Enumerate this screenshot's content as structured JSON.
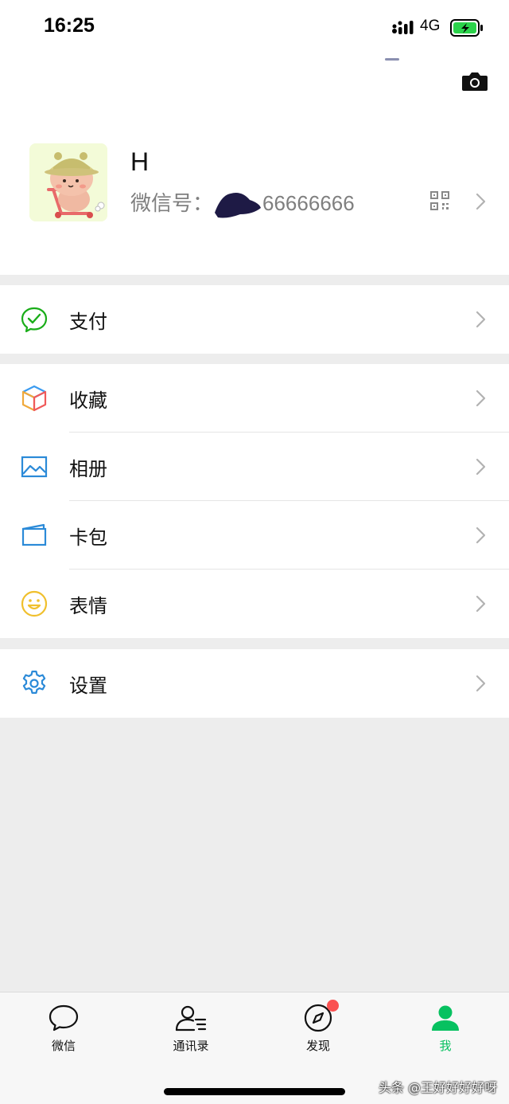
{
  "status_bar": {
    "time": "16:25",
    "network": "4G"
  },
  "profile": {
    "nickname": "H",
    "wechat_id_label": "微信号：",
    "wechat_id_visible": "66666666"
  },
  "menu": {
    "pay": "支付",
    "favorites": "收藏",
    "album": "相册",
    "cards": "卡包",
    "stickers": "表情",
    "settings": "设置"
  },
  "tabs": [
    {
      "label": "微信"
    },
    {
      "label": "通讯录"
    },
    {
      "label": "发现"
    },
    {
      "label": "我"
    }
  ],
  "watermark": "头条 @王好好好好呀",
  "colors": {
    "accent": "#07c160",
    "badge": "#fa5151",
    "background": "#ededed"
  }
}
